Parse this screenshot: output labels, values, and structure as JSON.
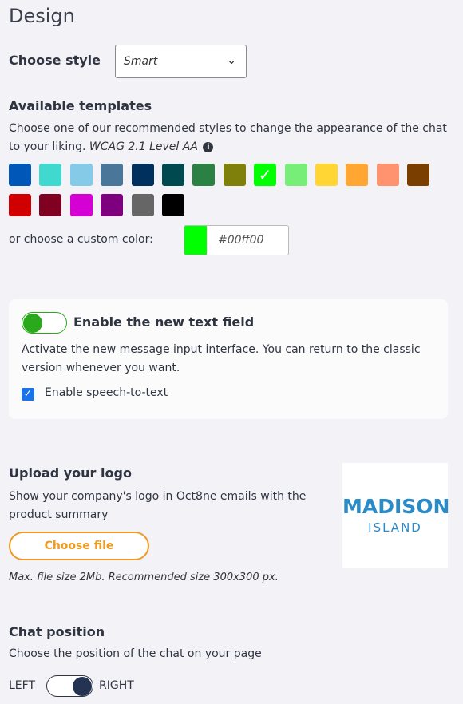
{
  "page": {
    "title": "Design"
  },
  "style": {
    "label": "Choose style",
    "selected": "Smart"
  },
  "templates": {
    "heading": "Available templates",
    "description": "Choose one of our recommended styles to change the appearance of the chat to your liking.",
    "wcag": "WCAG 2.1 Level AA",
    "info_icon": "info-circle-icon",
    "swatches": [
      "#0057b8",
      "#3fd9d0",
      "#85cbe8",
      "#4a7699",
      "#00305e",
      "#004a4f",
      "#2b8043",
      "#7f7f0b",
      "#00ff00",
      "#77ee77",
      "#ffd633",
      "#ffa633",
      "#ff9370",
      "#7a3f00",
      "#d10000",
      "#7f0020",
      "#d400d4",
      "#7f007f",
      "#666666",
      "#000000"
    ],
    "selected_index": 8,
    "custom_label": "or choose a custom color:",
    "custom_value": "#00ff00"
  },
  "text_field": {
    "toggle_label": "Enable the new text field",
    "enabled": true,
    "description": "Activate the new message input interface. You can return to the classic version whenever you want.",
    "speech_label": "Enable speech-to-text",
    "speech_checked": true
  },
  "logo": {
    "heading": "Upload your logo",
    "description": "Show your company's logo in Oct8ne emails with the product summary",
    "button": "Choose file",
    "note": "Max. file size 2Mb. Recommended size 300x300 px.",
    "logo_line1": "MADISON",
    "logo_line2": "ISLAND"
  },
  "position": {
    "heading": "Chat position",
    "description": "Choose the position of the chat on your page",
    "left_label": "LEFT",
    "right_label": "RIGHT",
    "selected": "RIGHT"
  }
}
